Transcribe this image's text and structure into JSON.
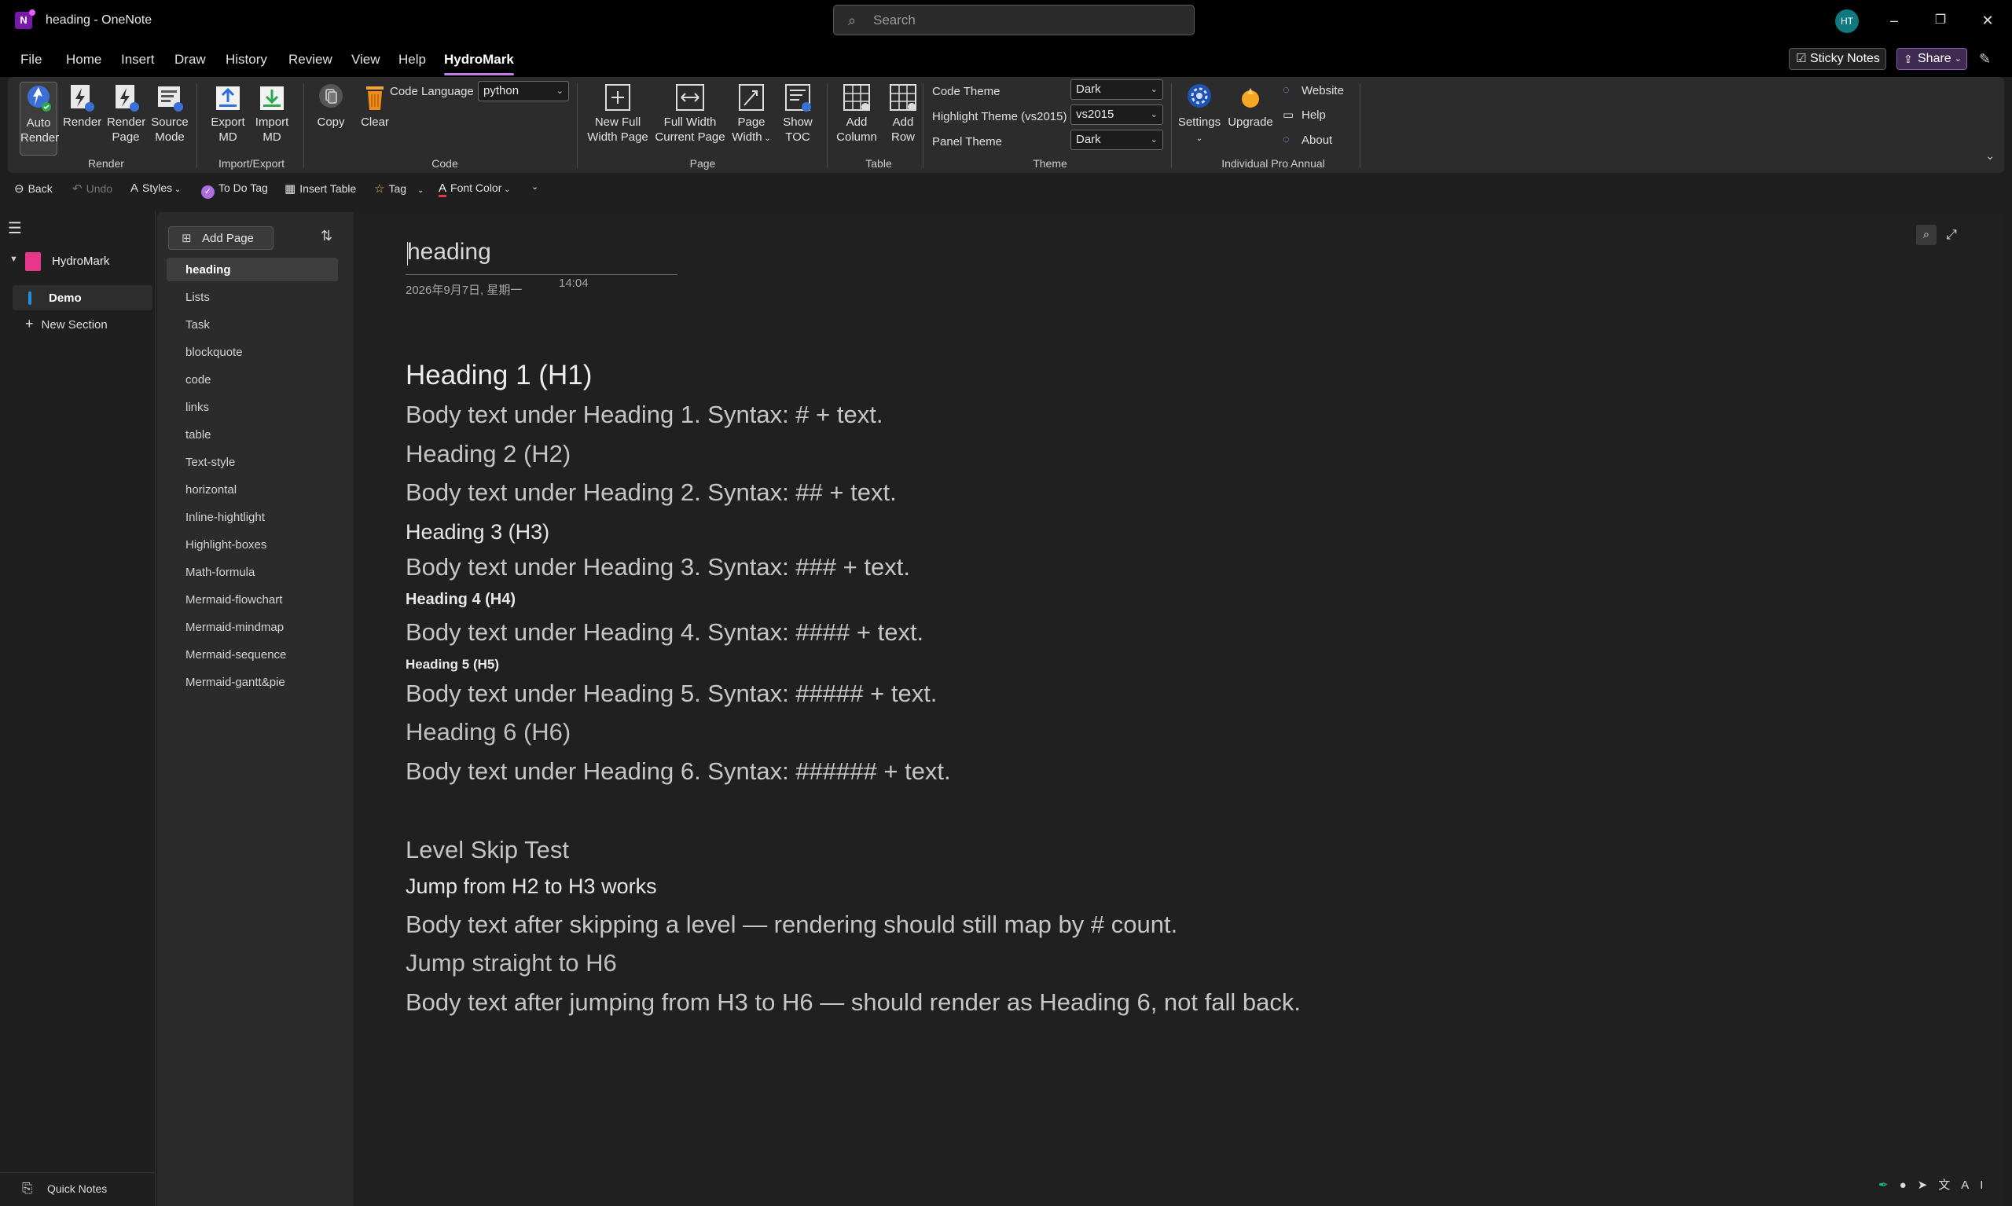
{
  "window": {
    "title": "heading  -  OneNote",
    "search_placeholder": "Search",
    "avatar_initials": "HT",
    "controls": [
      "–",
      "❐",
      "✕"
    ]
  },
  "menu": {
    "tabs": [
      "File",
      "Home",
      "Insert",
      "Draw",
      "History",
      "Review",
      "View",
      "Help",
      "HydroMark"
    ],
    "active_tab": "HydroMark",
    "sticky_notes": "Sticky Notes",
    "share": "Share"
  },
  "ribbon": {
    "render_group": {
      "label": "Render",
      "buttons": [
        {
          "line1": "Auto",
          "line2": "Render"
        },
        {
          "line1": "Render",
          "line2": ""
        },
        {
          "line1": "Render",
          "line2": "Page"
        },
        {
          "line1": "Source",
          "line2": "Mode"
        }
      ]
    },
    "import_group": {
      "label": "Import/Export",
      "buttons": [
        {
          "line1": "Export",
          "line2": "MD"
        },
        {
          "line1": "Import",
          "line2": "MD"
        }
      ]
    },
    "code_group": {
      "label": "Code",
      "copy": "Copy",
      "clear": "Clear",
      "code_language_label": "Code Language",
      "code_language_value": "python"
    },
    "page_group": {
      "label": "Page",
      "buttons": [
        {
          "line1": "New Full",
          "line2": "Width Page"
        },
        {
          "line1": "Full Width",
          "line2": "Current Page"
        },
        {
          "line1": "Page",
          "line2": "Width"
        },
        {
          "line1": "Show",
          "line2": "TOC"
        }
      ]
    },
    "table_group": {
      "label": "Table",
      "buttons": [
        {
          "line1": "Add",
          "line2": "Column"
        },
        {
          "line1": "Add",
          "line2": "Row"
        }
      ]
    },
    "theme_group": {
      "label": "Theme",
      "code_theme_label": "Code Theme",
      "code_theme_value": "Dark",
      "highlight_theme_label": "Highlight Theme (vs2015)",
      "highlight_theme_value": "vs2015",
      "panel_theme_label": "Panel Theme",
      "panel_theme_value": "Dark"
    },
    "license_group": {
      "label": "Individual Pro Annual",
      "settings": "Settings",
      "upgrade": "Upgrade",
      "website": "Website",
      "help": "Help",
      "about": "About"
    }
  },
  "quickbar": {
    "back": "Back",
    "undo": "Undo",
    "styles": "Styles",
    "todo_tag": "To Do Tag",
    "insert_table": "Insert Table",
    "tag": "Tag",
    "font_color": "Font Color"
  },
  "nav": {
    "notebook": "HydroMark",
    "section": "Demo",
    "new_section": "New Section",
    "quick_notes": "Quick Notes"
  },
  "pages": {
    "add_page": "Add Page",
    "items": [
      "heading",
      "Lists",
      "Task",
      "blockquote",
      "code",
      "links",
      "table",
      "Text-style",
      "horizontal",
      "Inline-hightlight",
      "Highlight-boxes",
      "Math-formula",
      "Mermaid-flowchart",
      "Mermaid-mindmap",
      "Mermaid-sequence",
      "Mermaid-gantt&pie"
    ],
    "active": "heading"
  },
  "note": {
    "title": "heading",
    "date": "2026年9月7日, 星期一",
    "time": "14:04",
    "lines": [
      {
        "style": "h1",
        "text": "Heading 1 (H1)"
      },
      {
        "style": "body",
        "text": "Body text under Heading 1. Syntax: # + text."
      },
      {
        "style": "h2",
        "text": "Heading 2 (H2)"
      },
      {
        "style": "body",
        "text": "Body text under Heading 2. Syntax: ## + text."
      },
      {
        "style": "h3",
        "text": "Heading 3 (H3)"
      },
      {
        "style": "body",
        "text": "Body text under Heading 3. Syntax: ### + text."
      },
      {
        "style": "h4",
        "text": "Heading 4 (H4)"
      },
      {
        "style": "body",
        "text": "Body text under Heading 4. Syntax: #### + text."
      },
      {
        "style": "h5",
        "text": "Heading 5 (H5)"
      },
      {
        "style": "body",
        "text": "Body text under Heading 5. Syntax: ##### + text."
      },
      {
        "style": "h6",
        "text": "Heading 6 (H6)"
      },
      {
        "style": "body",
        "text": "Body text under Heading 6. Syntax: ###### + text."
      },
      {
        "style": "h2",
        "text": "Level Skip Test"
      },
      {
        "style": "h3",
        "text": "Jump from H2 to H3 works"
      },
      {
        "style": "body",
        "text": "Body text after skipping a level — rendering should still map by # count."
      },
      {
        "style": "h6",
        "text": "Jump straight to H6"
      },
      {
        "style": "body",
        "text": "Body text after jumping from H3 to H6 — should render as Heading 6, not fall back."
      }
    ]
  },
  "colors": {
    "accent": "#c07de8",
    "section_bar": "#1f8fe0",
    "notebook": "#e8378a",
    "avatar": "#0e7a80"
  }
}
